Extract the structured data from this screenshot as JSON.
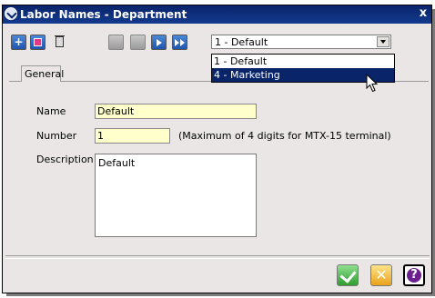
{
  "window": {
    "title": "Labor Names - Department",
    "close_label": "x"
  },
  "toolbar": {
    "buttons": [
      "add-icon",
      "save-icon",
      "delete-icon",
      "first-record-icon",
      "previous-record-icon",
      "next-record-icon",
      "last-record-icon"
    ]
  },
  "record_selector": {
    "selected": "1 - Default",
    "options": [
      "1 - Default",
      "4 - Marketing"
    ],
    "highlighted": "4 - Marketing"
  },
  "tabs": [
    {
      "label": "General"
    }
  ],
  "form": {
    "name_label": "Name",
    "name_value": "Default",
    "number_label": "Number",
    "number_value": "1",
    "number_hint": "(Maximum of 4 digits for MTX-15 terminal)",
    "description_label": "Description",
    "description_value": "Default"
  },
  "footer": {
    "buttons": [
      "ok-check-icon",
      "cancel-x-icon",
      "help-question-icon"
    ],
    "help_glyph": "?",
    "cancel_glyph": "✕"
  },
  "colors": {
    "title_bar": "#0a246a",
    "selection": "#0a246a",
    "field_bg": "#ffffcc",
    "window_bg": "#eae6e6"
  }
}
